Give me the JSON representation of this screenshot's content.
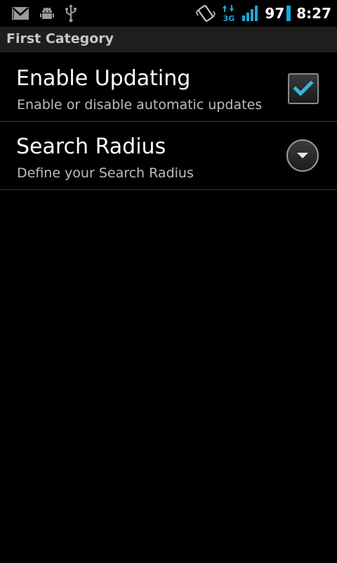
{
  "status_bar": {
    "battery_level": "97",
    "network_type": "3G",
    "time": "8:27",
    "accent_color": "#1aa6d8",
    "icons": [
      "gmail-icon",
      "android-debug-icon",
      "usb-icon",
      "vibrate-icon",
      "data-3g-icon",
      "signal-strength-icon",
      "battery-icon"
    ]
  },
  "preferences": {
    "category_title": "First Category",
    "items": [
      {
        "title": "Enable Updating",
        "summary": "Enable or disable automatic updates",
        "widget": "checkbox",
        "checked": true
      },
      {
        "title": "Search Radius",
        "summary": "Define your Search Radius",
        "widget": "dropdown"
      }
    ]
  }
}
